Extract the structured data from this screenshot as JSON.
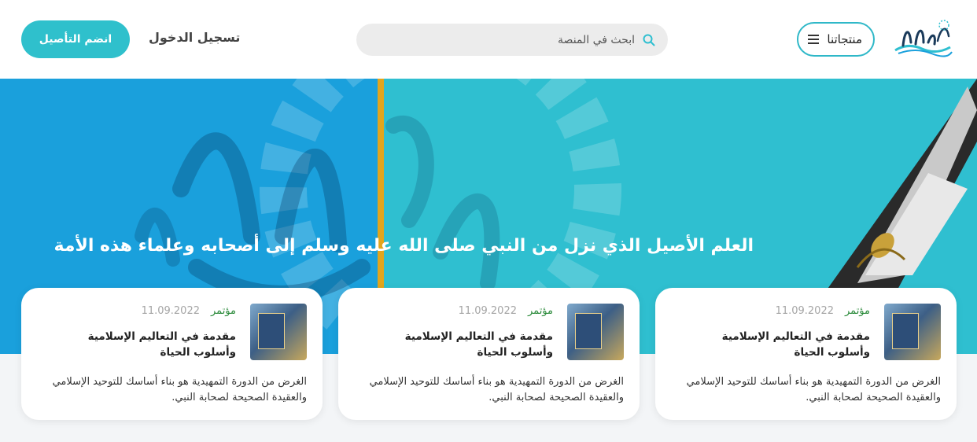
{
  "header": {
    "products_label": "منتجاتنا",
    "search_placeholder": "ابحث في المنصة",
    "login_label": "تسجيل الدخول",
    "join_label": "انضم التأصيل"
  },
  "hero": {
    "title": "العلم الأصيل الذي نزل من النبي صلى الله عليه وسلم إلى أصحابه وعلماء هذه الأمة"
  },
  "cards": [
    {
      "tag": "مؤتمر",
      "date": "11.09.2022",
      "title": "مقدمة في التعاليم الإسلامية وأسلوب الحياة",
      "description": "الغرض من الدورة التمهيدية هو بناء أساسك للتوحيد الإسلامي والعقيدة الصحيحة لصحابة النبي."
    },
    {
      "tag": "مؤتمر",
      "date": "11.09.2022",
      "title": "مقدمة في التعاليم الإسلامية وأسلوب الحياة",
      "description": "الغرض من الدورة التمهيدية هو بناء أساسك للتوحيد الإسلامي والعقيدة الصحيحة لصحابة النبي."
    },
    {
      "tag": "مؤتمر",
      "date": "11.09.2022",
      "title": "مقدمة في التعاليم الإسلامية وأسلوب الحياة",
      "description": "الغرض من الدورة التمهيدية هو بناء أساسك للتوحيد الإسلامي والعقيدة الصحيحة لصحابة النبي."
    }
  ],
  "colors": {
    "accent": "#2fbfd0",
    "hero_left": "#1aa0dc",
    "divider": "#e2a51c",
    "tag": "#2a8a3a"
  },
  "icons": {
    "menu": "hamburger-icon",
    "search": "search-icon",
    "logo": "calligraphy-logo"
  }
}
